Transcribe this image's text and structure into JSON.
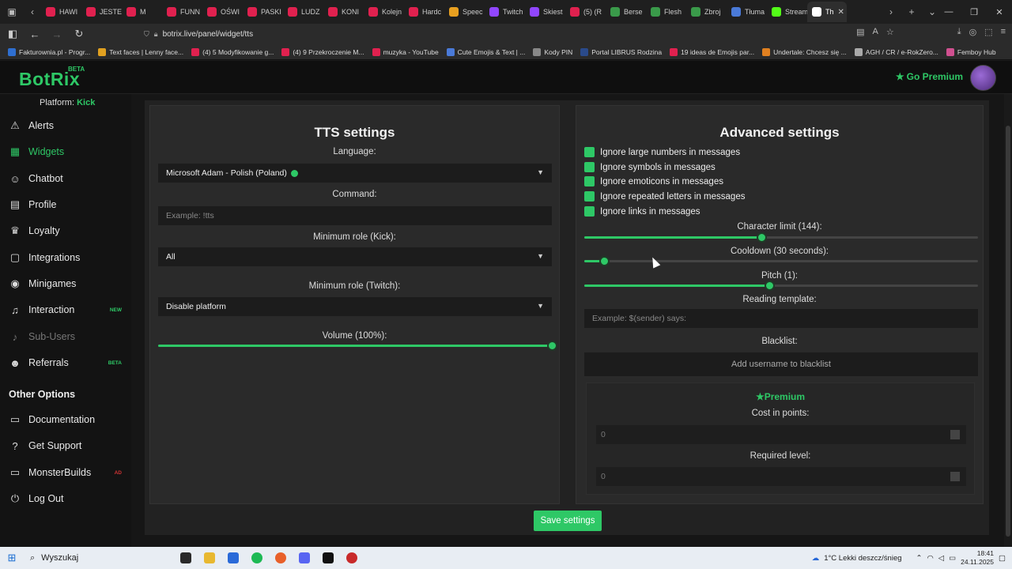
{
  "browser": {
    "tabs": [
      {
        "label": "HAWI",
        "color": "#e0214f"
      },
      {
        "label": "JESTE",
        "color": "#e0214f"
      },
      {
        "label": "M",
        "color": "#e0214f"
      },
      {
        "label": "FUNN",
        "color": "#e0214f"
      },
      {
        "label": "OŚWI",
        "color": "#e0214f"
      },
      {
        "label": "PASKI",
        "color": "#e0214f"
      },
      {
        "label": "LUDZ",
        "color": "#e0214f"
      },
      {
        "label": "KONI",
        "color": "#e0214f"
      },
      {
        "label": "Kolejn",
        "color": "#e0214f"
      },
      {
        "label": "Hardc",
        "color": "#e0214f"
      },
      {
        "label": "Speec",
        "color": "#e8a020"
      },
      {
        "label": "Twitch",
        "color": "#9146ff"
      },
      {
        "label": "Skiest",
        "color": "#9146ff"
      },
      {
        "label": "(5) (R",
        "color": "#e0214f"
      },
      {
        "label": "Berse",
        "color": "#3a9a4a"
      },
      {
        "label": "Flesh",
        "color": "#3a9a4a"
      },
      {
        "label": "Zbroj",
        "color": "#3a9a4a"
      },
      {
        "label": "Tłuma",
        "color": "#4a7ad8"
      },
      {
        "label": "Stream",
        "color": "#53fc18"
      },
      {
        "label": "Th",
        "color": "#ffffff",
        "active": true
      }
    ],
    "url": "botrix.live/panel/widget/tts",
    "bookmarks": [
      {
        "label": "Fakturownia.pl - Progr...",
        "color": "#2f6fd0"
      },
      {
        "label": "Text faces | Lenny face...",
        "color": "#e0a020"
      },
      {
        "label": "(4) 5 Modyfikowanie g...",
        "color": "#e0214f"
      },
      {
        "label": "(4) 9 Przekroczenie M...",
        "color": "#e0214f"
      },
      {
        "label": "muzyka - YouTube",
        "color": "#e0214f"
      },
      {
        "label": "Cute Emojis & Text | ...",
        "color": "#4a7ad8"
      },
      {
        "label": "Kody PIN",
        "color": "#888888"
      },
      {
        "label": "Portal LIBRUS Rodzina",
        "color": "#2a4a8a"
      },
      {
        "label": "19 ideas de Emojis par...",
        "color": "#e0214f"
      },
      {
        "label": "Undertale: Chcesz się ...",
        "color": "#e08020"
      },
      {
        "label": "AGH / CR / e-RokZero...",
        "color": "#aaaaaa"
      },
      {
        "label": "Femboy Hub",
        "color": "#d05090"
      }
    ]
  },
  "app": {
    "logo": "BotRix",
    "logo_badge": "BETA",
    "premium_link": "Go Premium",
    "platform_label": "Platform:",
    "platform_value": "Kick",
    "sidebar": [
      {
        "label": "Alerts",
        "icon": "⚠"
      },
      {
        "label": "Widgets",
        "icon": "▦",
        "active": true
      },
      {
        "label": "Chatbot",
        "icon": "☺"
      },
      {
        "label": "Profile",
        "icon": "▤"
      },
      {
        "label": "Loyalty",
        "icon": "♛"
      },
      {
        "label": "Integrations",
        "icon": "▢"
      },
      {
        "label": "Minigames",
        "icon": "◉"
      },
      {
        "label": "Interaction",
        "icon": "♫",
        "badge": "NEW"
      },
      {
        "label": "Sub-Users",
        "icon": "♪",
        "disabled": true
      },
      {
        "label": "Referrals",
        "icon": "☻",
        "badge": "BETA"
      }
    ],
    "other_options_title": "Other Options",
    "other_options": [
      {
        "label": "Documentation",
        "icon": "▭"
      },
      {
        "label": "Get Support",
        "icon": "?"
      },
      {
        "label": "MonsterBuilds",
        "icon": "▭",
        "badge": "AD"
      },
      {
        "label": "Log Out",
        "icon": "⏻"
      }
    ],
    "tts": {
      "title": "TTS settings",
      "language_label": "Language:",
      "language_value": "Microsoft Adam - Polish (Poland)",
      "command_label": "Command:",
      "command_placeholder": "Example: !tts",
      "min_role_kick_label": "Minimum role (Kick):",
      "min_role_kick_value": "All",
      "min_role_twitch_label": "Minimum role (Twitch):",
      "min_role_twitch_value": "Disable platform",
      "volume_label": "Volume (100%):",
      "volume_fraction": 1.0
    },
    "advanced": {
      "title": "Advanced settings",
      "checkboxes": [
        "Ignore large numbers in messages",
        "Ignore symbols in messages",
        "Ignore emoticons in messages",
        "Ignore repeated letters in messages",
        "Ignore links in messages"
      ],
      "char_limit_label": "Character limit (144):",
      "char_limit_fraction": 0.45,
      "cooldown_label": "Cooldown (30 seconds):",
      "cooldown_fraction": 0.05,
      "pitch_label": "Pitch (1):",
      "pitch_fraction": 0.47,
      "template_label": "Reading template:",
      "template_placeholder": "Example: $(sender) says:",
      "blacklist_label": "Blacklist:",
      "blacklist_button": "Add username to blacklist",
      "premium_title": "Premium",
      "cost_label": "Cost in points:",
      "cost_value": "0",
      "level_label": "Required level:",
      "level_value": "0"
    },
    "save_button": "Save settings",
    "accent": "#2ec866"
  },
  "taskbar": {
    "search_placeholder": "Wyszukaj",
    "weather": "1°C  Lekki deszcz/śnieg",
    "time": "18:41",
    "date": "24.11.2025"
  }
}
